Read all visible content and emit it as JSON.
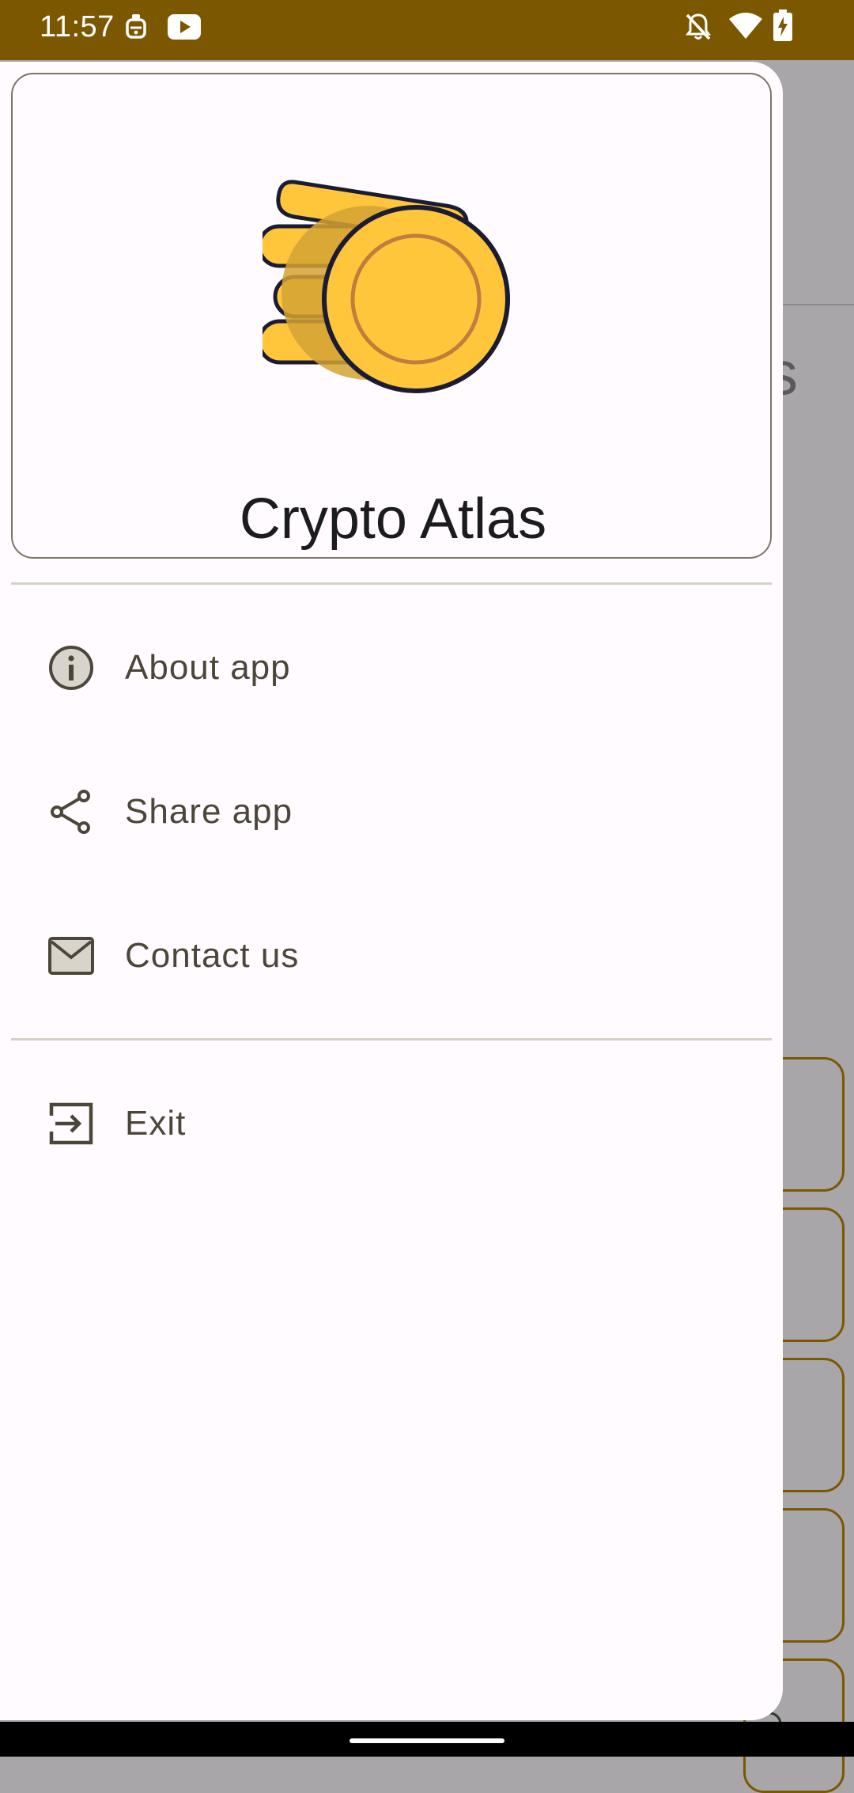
{
  "status_bar": {
    "time": "11:57",
    "icons": [
      "robot-face-icon",
      "youtube-icon",
      "notifications-off-icon",
      "wifi-icon",
      "battery-charging-icon"
    ],
    "background_color": "#7b5700"
  },
  "drawer": {
    "app_name": "Crypto Atlas",
    "logo": "coin-hand-logo",
    "menu": [
      {
        "label": "About app",
        "icon": "info-icon"
      },
      {
        "label": "Share app",
        "icon": "share-icon"
      },
      {
        "label": "Contact us",
        "icon": "mail-icon"
      }
    ],
    "secondary_menu": [
      {
        "label": "Exit",
        "icon": "exit-icon"
      }
    ]
  },
  "background_screen": {
    "partial_heading_letter": "s"
  },
  "colors": {
    "accent": "#7b5700",
    "coin_yellow": "#ffc63c",
    "coin_ring": "#c07e3c",
    "outline": "#1b1b33",
    "drawer_surface": "#fffbfe",
    "menu_text": "#4c463a"
  }
}
